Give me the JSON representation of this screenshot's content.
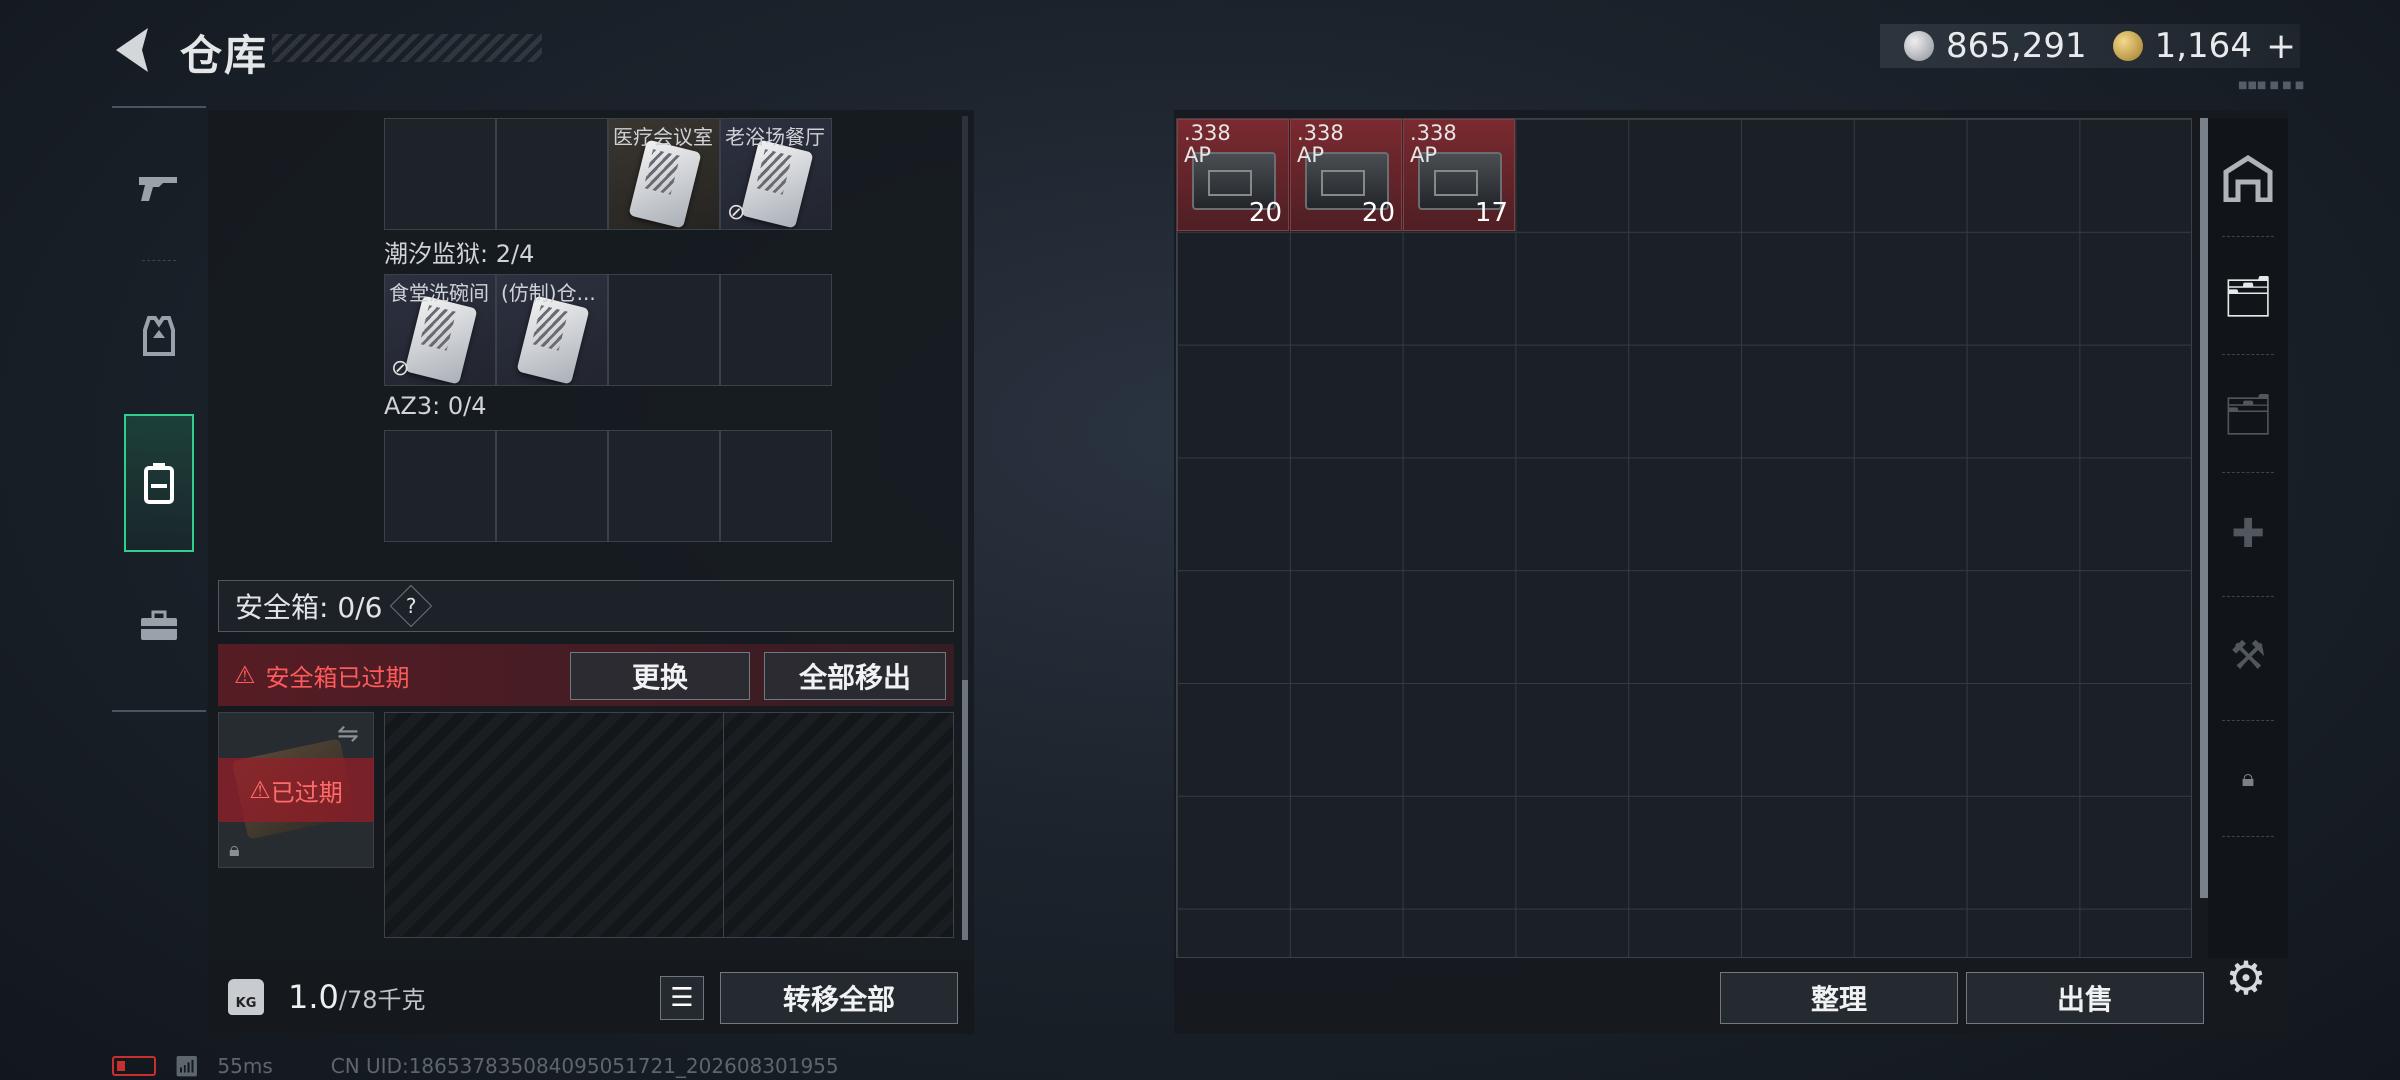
{
  "header": {
    "title": "仓库",
    "silver": "865,291",
    "gold": "1,164",
    "plus": "+",
    "tiny": "■■■ ■ ■ ■"
  },
  "nav": {
    "icons": [
      "gun-icon",
      "vest-icon",
      "backpack-icon",
      "toolbox-icon"
    ]
  },
  "left": {
    "slot_labels": [
      "医疗会议室",
      "老浴场餐厅",
      "食堂洗碗间",
      "(仿制)仓..."
    ],
    "group_prison": "潮汐监狱: 2/4",
    "group_az3": "AZ3: 0/4",
    "safebox_title": "安全箱: 0/6",
    "safebox_help": "?",
    "expired_msg": "安全箱已过期",
    "btn_replace": "更换",
    "btn_remove_all": "全部移出",
    "expired_tag": "已过期",
    "weight_current": "1.0",
    "weight_max": "/78千克",
    "kg_label": "KG",
    "btn_transfer_all": "转移全部"
  },
  "right": {
    "ammo": [
      {
        "name": ".338\nAP",
        "qty": "20"
      },
      {
        "name": ".338\nAP",
        "qty": "20"
      },
      {
        "name": ".338\nAP",
        "qty": "17"
      }
    ],
    "btn_sort": "整理",
    "btn_sell": "出售"
  },
  "status": {
    "ping": "55ms",
    "uid": "CN UID:186537835084095051721_202608301955"
  }
}
